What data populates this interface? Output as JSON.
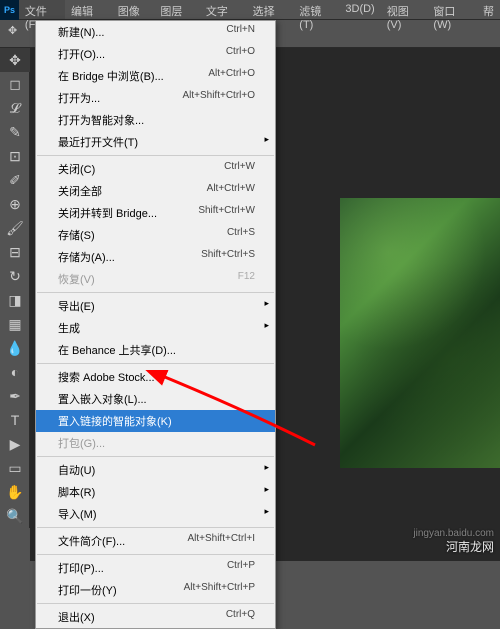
{
  "menubar": {
    "items": [
      "文件(F)",
      "编辑(E)",
      "图像(I)",
      "图层(L)",
      "文字(Y)",
      "选择(S)",
      "滤镜(T)",
      "3D(D)",
      "视图(V)",
      "窗口(W)",
      "帮"
    ]
  },
  "ps_logo": "Ps",
  "dropdown": {
    "groups": [
      [
        {
          "label": "新建(N)...",
          "shortcut": "Ctrl+N"
        },
        {
          "label": "打开(O)...",
          "shortcut": "Ctrl+O"
        },
        {
          "label": "在 Bridge 中浏览(B)...",
          "shortcut": "Alt+Ctrl+O"
        },
        {
          "label": "打开为...",
          "shortcut": "Alt+Shift+Ctrl+O"
        },
        {
          "label": "打开为智能对象...",
          "shortcut": ""
        },
        {
          "label": "最近打开文件(T)",
          "shortcut": "",
          "submenu": true
        }
      ],
      [
        {
          "label": "关闭(C)",
          "shortcut": "Ctrl+W"
        },
        {
          "label": "关闭全部",
          "shortcut": "Alt+Ctrl+W"
        },
        {
          "label": "关闭并转到 Bridge...",
          "shortcut": "Shift+Ctrl+W"
        },
        {
          "label": "存储(S)",
          "shortcut": "Ctrl+S"
        },
        {
          "label": "存储为(A)...",
          "shortcut": "Shift+Ctrl+S"
        },
        {
          "label": "恢复(V)",
          "shortcut": "F12",
          "disabled": true
        }
      ],
      [
        {
          "label": "导出(E)",
          "shortcut": "",
          "submenu": true
        },
        {
          "label": "生成",
          "shortcut": "",
          "submenu": true
        },
        {
          "label": "在 Behance 上共享(D)...",
          "shortcut": ""
        }
      ],
      [
        {
          "label": "搜索 Adobe Stock...",
          "shortcut": ""
        },
        {
          "label": "置入嵌入对象(L)...",
          "shortcut": ""
        },
        {
          "label": "置入链接的智能对象(K)",
          "shortcut": "",
          "highlighted": true
        },
        {
          "label": "打包(G)...",
          "shortcut": "",
          "disabled": true
        }
      ],
      [
        {
          "label": "自动(U)",
          "shortcut": "",
          "submenu": true
        },
        {
          "label": "脚本(R)",
          "shortcut": "",
          "submenu": true
        },
        {
          "label": "导入(M)",
          "shortcut": "",
          "submenu": true
        }
      ],
      [
        {
          "label": "文件简介(F)...",
          "shortcut": "Alt+Shift+Ctrl+I"
        }
      ],
      [
        {
          "label": "打印(P)...",
          "shortcut": "Ctrl+P"
        },
        {
          "label": "打印一份(Y)",
          "shortcut": "Alt+Shift+Ctrl+P"
        }
      ],
      [
        {
          "label": "退出(X)",
          "shortcut": "Ctrl+Q"
        }
      ]
    ]
  },
  "watermark": "河南龙网",
  "watermark2": "jingyan.baidu.com"
}
